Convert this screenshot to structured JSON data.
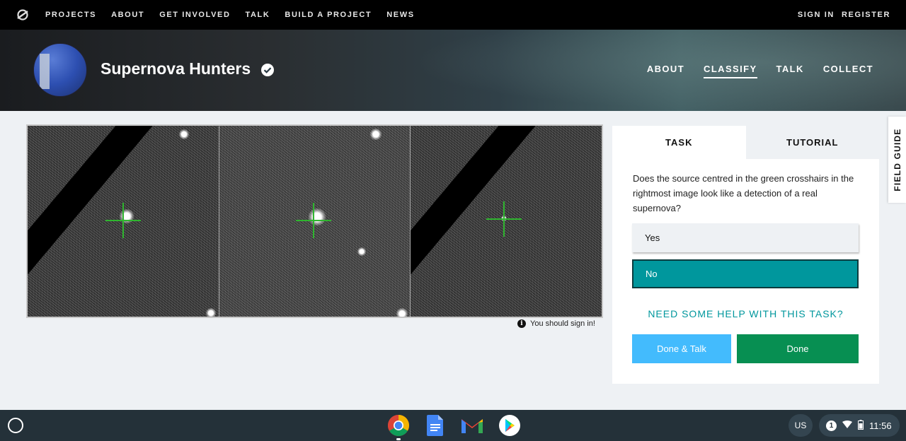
{
  "topnav": {
    "items": [
      "PROJECTS",
      "ABOUT",
      "GET INVOLVED",
      "TALK",
      "BUILD A PROJECT",
      "NEWS"
    ],
    "signin": "SIGN IN",
    "register": "REGISTER"
  },
  "project": {
    "title": "Supernova Hunters",
    "nav": [
      "ABOUT",
      "CLASSIFY",
      "TALK",
      "COLLECT"
    ],
    "active_nav": "CLASSIFY"
  },
  "viewer": {
    "signin_note": "You should sign in!"
  },
  "task": {
    "tabs": [
      "TASK",
      "TUTORIAL"
    ],
    "question": "Does the source centred in the green crosshairs in the rightmost image look like a detection of a real supernova?",
    "answers": [
      "Yes",
      "No"
    ],
    "selected_answer": "No",
    "help_link": "NEED SOME HELP WITH THIS TASK?",
    "done_talk": "Done & Talk",
    "done": "Done"
  },
  "field_guide": "FIELD GUIDE",
  "taskbar": {
    "apps": [
      "chrome-icon",
      "docs-icon",
      "gmail-icon",
      "play-store-icon"
    ],
    "ime": "US",
    "notification_count": "1",
    "time": "11:56"
  },
  "colors": {
    "teal": "#00979d",
    "done_green": "#078f52",
    "talk_blue": "#43bbfd",
    "crosshair": "#2fb52f"
  }
}
